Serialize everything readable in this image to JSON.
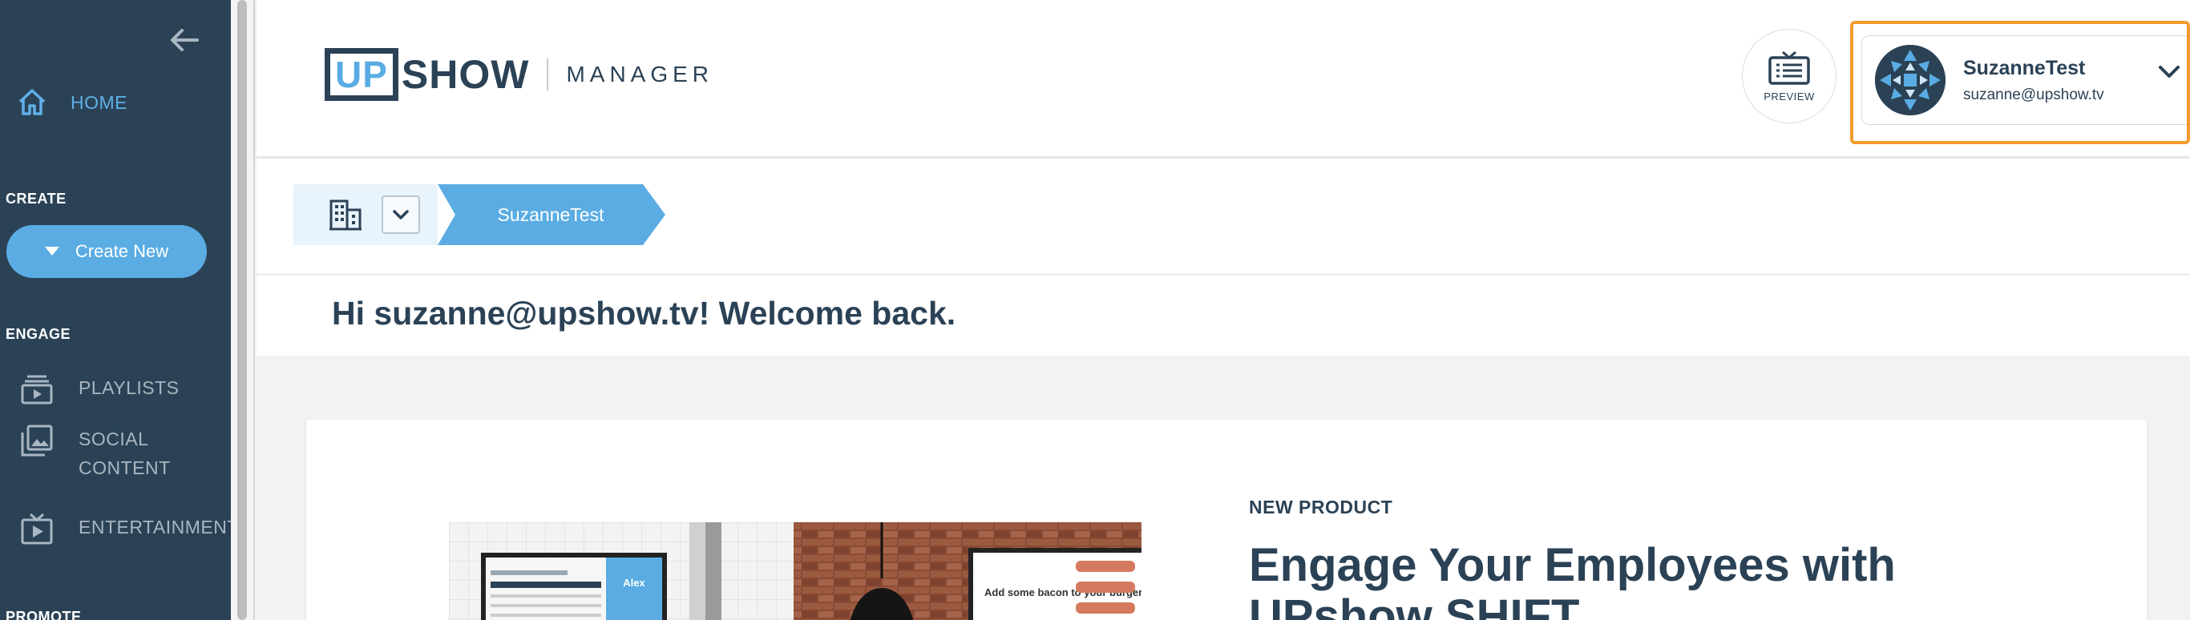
{
  "sidebar": {
    "home_label": "HOME",
    "create_section": "CREATE",
    "create_button": "Create New",
    "engage_section": "ENGAGE",
    "items": [
      {
        "label": "PLAYLISTS",
        "icon": "playlist-icon"
      },
      {
        "label": "SOCIAL CONTENT",
        "icon": "image-gallery-icon"
      },
      {
        "label": "ENTERTAINMENT",
        "icon": "tv-play-icon"
      }
    ],
    "promote_section": "PROMOTE"
  },
  "header": {
    "logo_up": "UP",
    "logo_show": "SHOW",
    "logo_product": "MANAGER",
    "preview_label": "PREVIEW",
    "user": {
      "name": "SuzanneTest",
      "email": "suzanne@upshow.tv"
    }
  },
  "breadcrumb": {
    "root_icon": "building-icon",
    "active": "SuzanneTest"
  },
  "welcome": "Hi suzanne@upshow.tv! Welcome back.",
  "promo": {
    "tag": "NEW PRODUCT",
    "title": "Engage Your Employees with UPshow SHIFT",
    "screen_name": "Alex",
    "screen_caption": "Add some bacon to your burger!"
  },
  "colors": {
    "sidebar_bg": "#2b4256",
    "accent": "#5aace3",
    "focus_outline": "#f29a2e",
    "text_dark": "#2b4256"
  }
}
